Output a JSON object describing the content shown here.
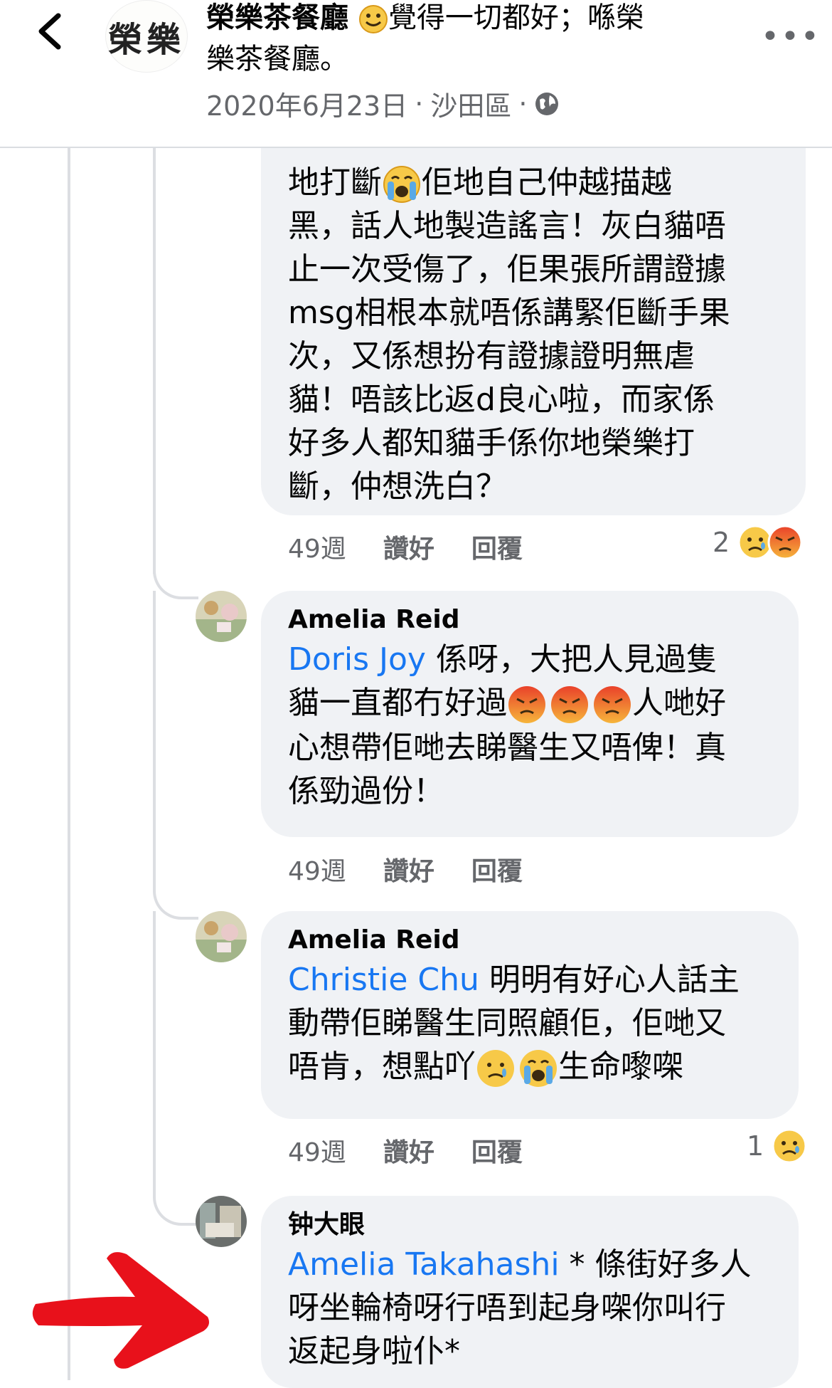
{
  "header": {
    "page_name": "榮樂茶餐廳",
    "title_rest_1": "覺得一切都好；喺榮",
    "title_rest_2": "樂茶餐廳。",
    "logo_text": "榮樂",
    "date": "2020年6月23日",
    "location": "沙田區",
    "separator": "·"
  },
  "comments": [
    {
      "text_1": "地打斷",
      "text_2": "佢地自己仲越描越",
      "text_rest": [
        "黑，話人地製造謠言！灰白貓唔",
        "止一次受傷了，佢果張所謂證據",
        "msg相根本就唔係講緊佢斷手果",
        "次，又係想扮有證據證明無虐",
        "貓！唔該比返d良心啦，而家係",
        "好多人都知貓手係你地榮樂打",
        "斷，仲想洗白？"
      ],
      "time": "49週",
      "like": "讚好",
      "reply": "回覆",
      "reaction_count": "2"
    },
    {
      "author": "Amelia Reid",
      "mention": "Doris Joy",
      "line1": " 係呀，大把人見過隻",
      "line2a": "貓一直都冇好過",
      "line2b": "人哋好",
      "line3": "心想帶佢哋去睇醫生又唔俾！真",
      "line4": "係勁過份！",
      "time": "49週",
      "like": "讚好",
      "reply": "回覆"
    },
    {
      "author": "Amelia Reid",
      "mention": "Christie Chu",
      "line1": " 明明有好心人話主",
      "line2": "動帶佢睇醫生同照顧佢，佢哋又",
      "line3a": "唔肯，想點吖",
      "line3b": "生命嚟㗎",
      "time": "49週",
      "like": "讚好",
      "reply": "回覆",
      "reaction_count": "1"
    },
    {
      "author": "钟大眼",
      "mention": "Amelia Takahashi",
      "line1": " * 條街好多人",
      "line2": "呀坐輪椅呀行唔到起身㗎你叫行",
      "line3": "返起身啦仆*"
    }
  ],
  "colors": {
    "mention": "#1877f2",
    "bubble": "#f0f2f5",
    "muted": "#65676b",
    "arrow": "#e8111b"
  },
  "icons": [
    "back-chevron-icon",
    "more-dots-icon",
    "globe-icon",
    "crying-emoji",
    "sad-emoji",
    "angry-emoji",
    "red-arrow"
  ]
}
